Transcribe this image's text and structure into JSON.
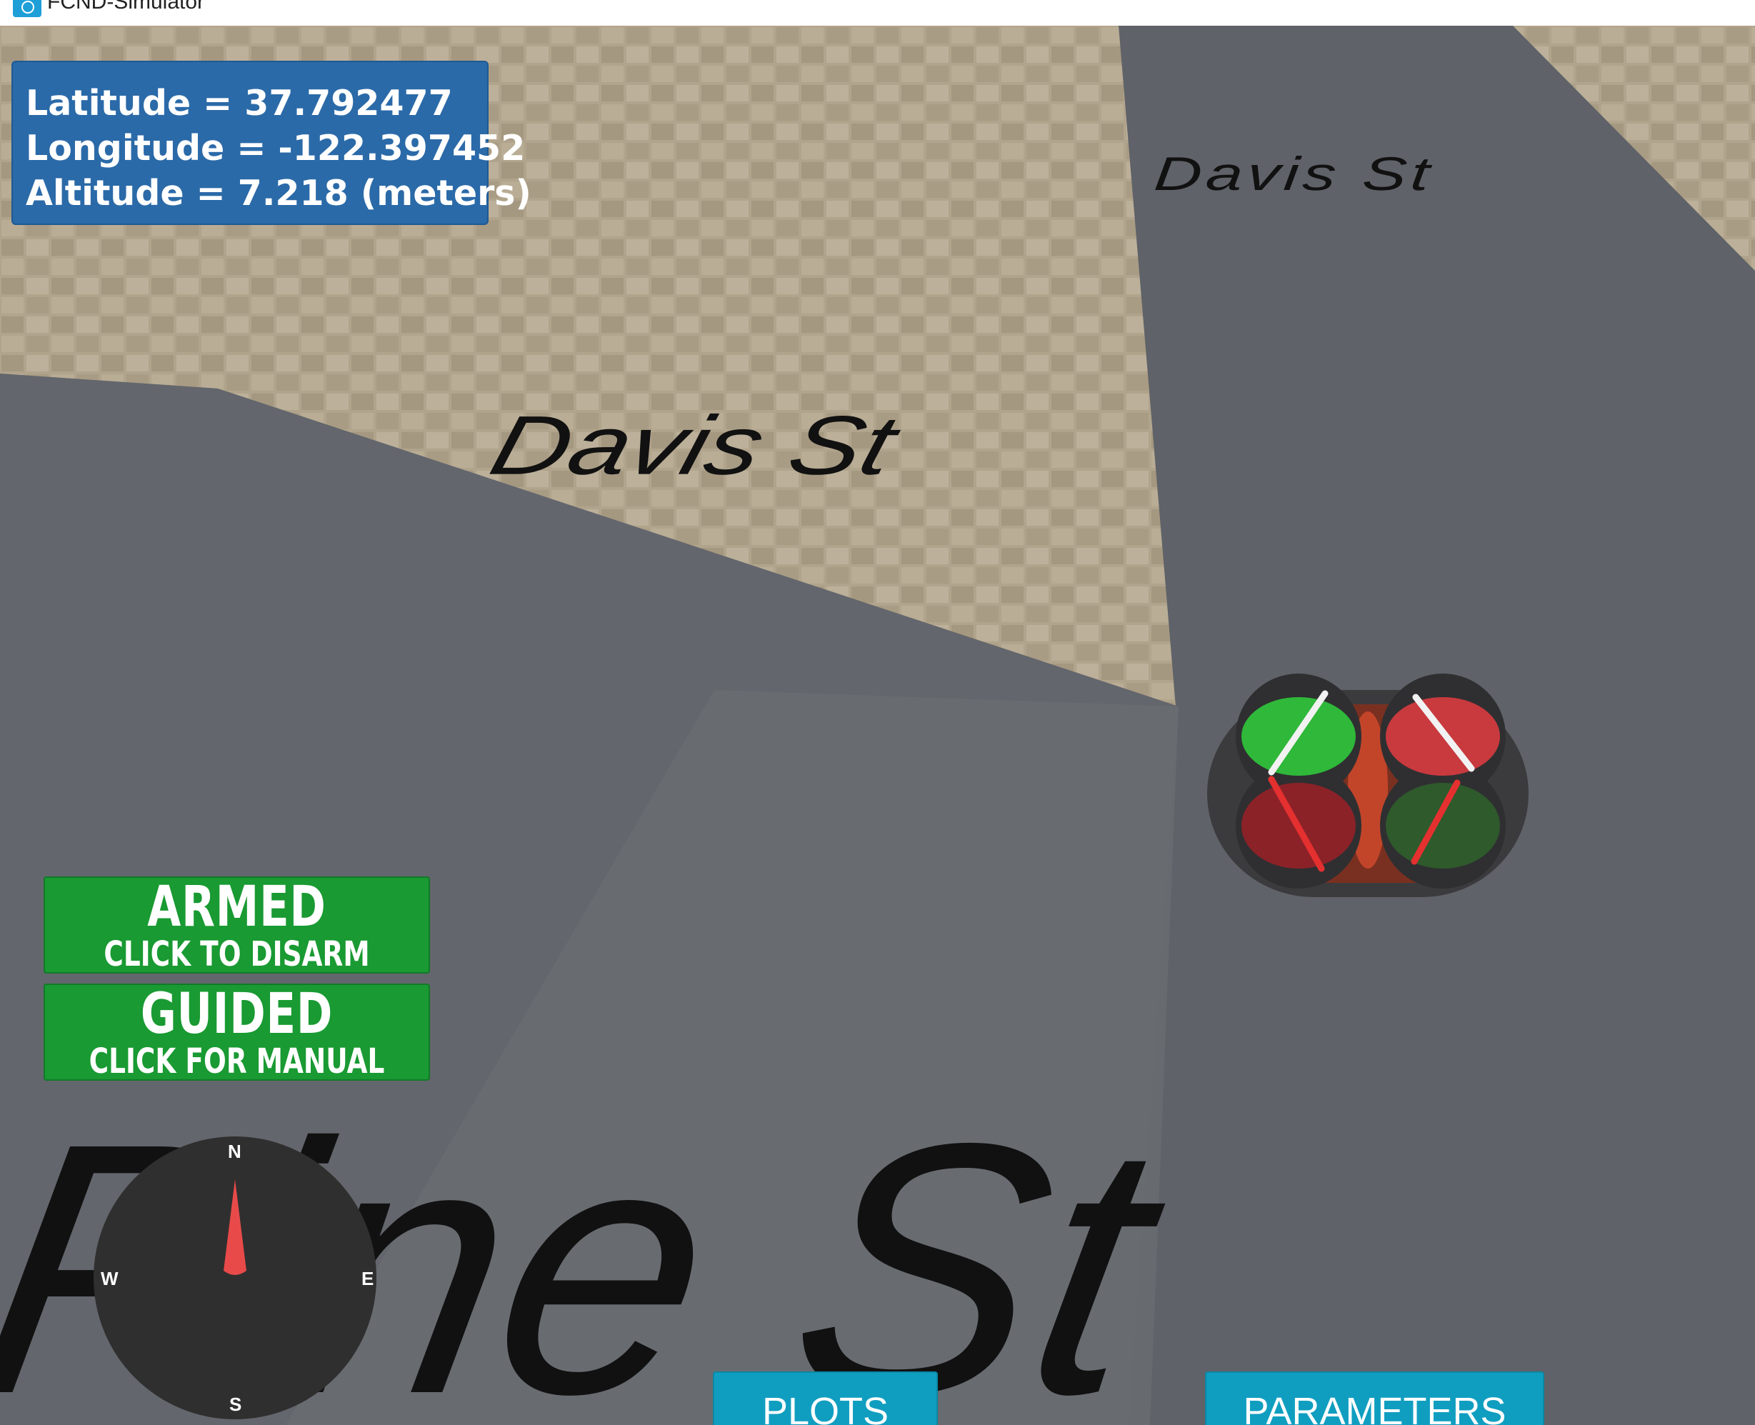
{
  "window": {
    "title": "FCND-Simulator"
  },
  "telemetry": {
    "latitude": "Latitude = 37.792477",
    "longitude": "Longitude = -122.397452",
    "altitude": "Altitude = 7.218 (meters)"
  },
  "street_labels": {
    "davis_near": "Davis St",
    "davis_far": "Davis St",
    "pine": "Pine St"
  },
  "controls": {
    "armed": {
      "main": "ARMED",
      "sub": "CLICK TO DISARM"
    },
    "guided": {
      "main": "GUIDED",
      "sub": "CLICK FOR MANUAL"
    }
  },
  "compass": {
    "n": "N",
    "s": "S",
    "w": "W",
    "e": "E",
    "needle_color": "#e84a4a"
  },
  "buttons": {
    "plots": "PLOTS",
    "parameters": "PARAMETERS"
  },
  "colors": {
    "panel_blue": "#2b6aa8",
    "armed_green": "#199a32",
    "button_teal": "#109ec0",
    "road_gray": "#62656b",
    "pavement": "#b1a48c"
  },
  "icons": {
    "drone": "quadcopter-icon",
    "app": "unity-app-icon"
  }
}
